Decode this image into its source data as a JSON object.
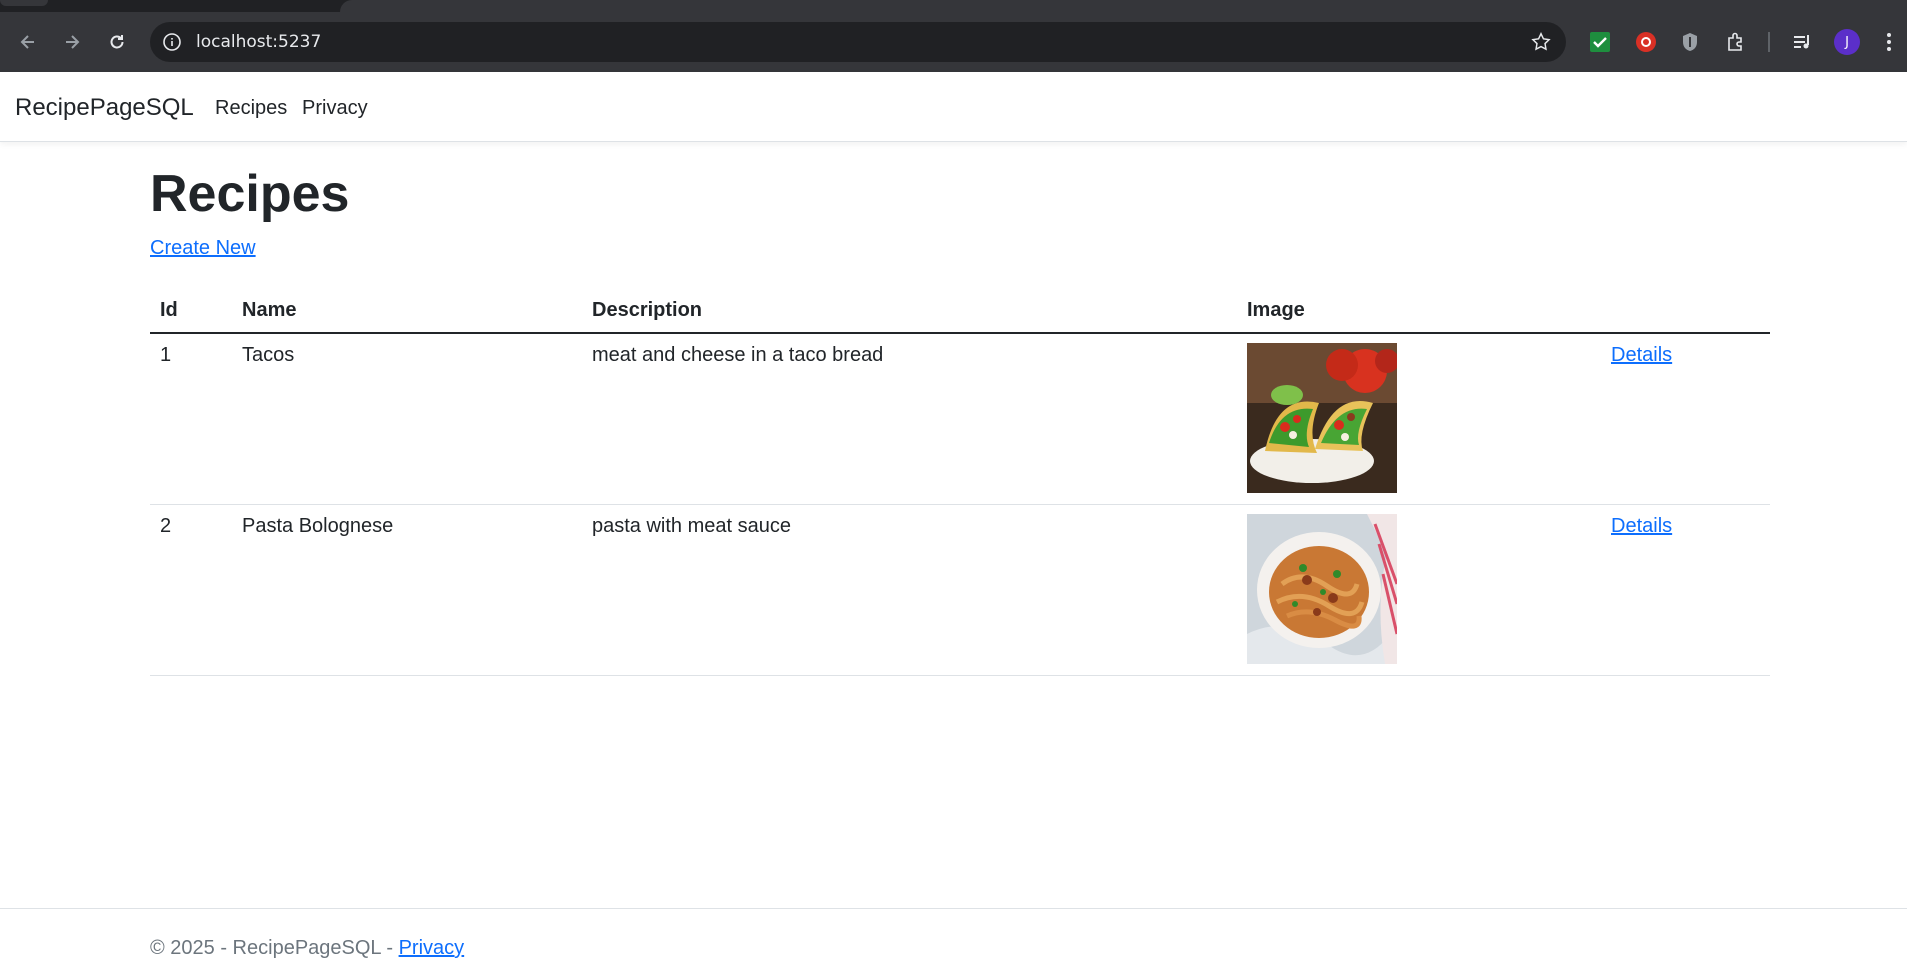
{
  "browser": {
    "url": "localhost:5237",
    "profile_initial": "J"
  },
  "navbar": {
    "brand": "RecipePageSQL",
    "links": [
      "Recipes",
      "Privacy"
    ]
  },
  "page": {
    "title": "Recipes",
    "create_link": "Create New"
  },
  "table": {
    "headers": [
      "Id",
      "Name",
      "Description",
      "Image",
      ""
    ],
    "rows": [
      {
        "id": "1",
        "name": "Tacos",
        "description": "meat and cheese in a taco bread",
        "action": "Details"
      },
      {
        "id": "2",
        "name": "Pasta Bolognese",
        "description": "pasta with meat sauce",
        "action": "Details"
      }
    ]
  },
  "footer": {
    "text": "© 2025 - RecipePageSQL - ",
    "link": "Privacy"
  },
  "colors": {
    "link": "#0d6efd",
    "chrome_dark": "#202124",
    "chrome_toolbar": "#35363a"
  }
}
